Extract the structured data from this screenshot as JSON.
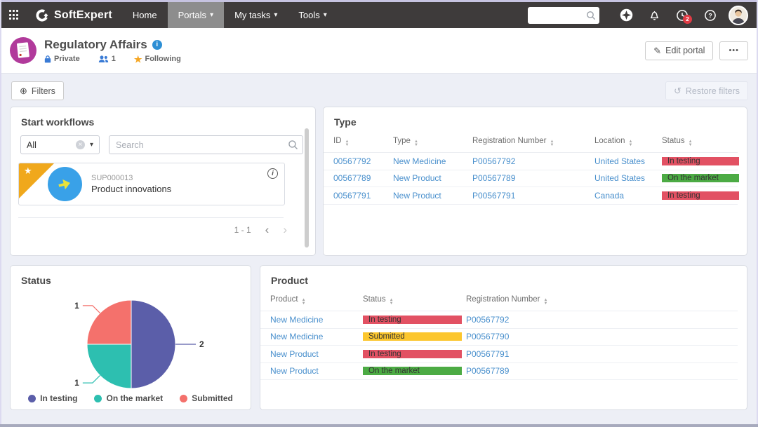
{
  "icons": {
    "caret_down": "▾",
    "sort_up": "▲",
    "sort_down": "▼",
    "ellipsis": "•••",
    "info": "i",
    "plus_circle": "⊕",
    "restore": "↺",
    "pencil": "✎",
    "star": "★",
    "clear": "×",
    "chevron_left": "‹",
    "chevron_right": "›"
  },
  "navbar": {
    "brand": "SoftExpert",
    "menu": [
      {
        "label": "Home",
        "active": false
      },
      {
        "label": "Portals",
        "active": true
      },
      {
        "label": "My tasks",
        "active": false
      },
      {
        "label": "Tools",
        "active": false
      }
    ],
    "search_value": "",
    "history_badge": "2"
  },
  "header": {
    "title": "Regulatory Affairs",
    "visibility": "Private",
    "members_count": "1",
    "following_label": "Following",
    "edit_portal_label": "Edit portal"
  },
  "filters_bar": {
    "filters_label": "Filters",
    "restore_label": "Restore filters"
  },
  "start_workflows": {
    "title": "Start workflows",
    "category_filter_value": "All",
    "search_placeholder": "Search",
    "cards": [
      {
        "id": "SUP000013",
        "name": "Product innovations"
      }
    ],
    "pagination": "1 - 1"
  },
  "type_panel": {
    "title": "Type",
    "columns": [
      "ID",
      "Type",
      "Registration Number",
      "Location",
      "Status"
    ],
    "rows": [
      {
        "id": "00567792",
        "type": "New Medicine",
        "registration_number": "P00567792",
        "location": "United States",
        "status": "In testing",
        "status_color": "#e25163"
      },
      {
        "id": "00567789",
        "type": "New Product",
        "registration_number": "P00567789",
        "location": "United States",
        "status": "On the market",
        "status_color": "#4cab44"
      },
      {
        "id": "00567791",
        "type": "New Product",
        "registration_number": "P00567791",
        "location": "Canada",
        "status": "In testing",
        "status_color": "#e25163"
      }
    ]
  },
  "status_panel": {
    "title": "Status"
  },
  "product_panel": {
    "title": "Product",
    "columns": [
      "Product",
      "Status",
      "Registration Number"
    ],
    "rows": [
      {
        "product": "New Medicine",
        "status": "In testing",
        "status_color": "#e25163",
        "registration_number": "P00567792"
      },
      {
        "product": "New Medicine",
        "status": "Submitted",
        "status_color": "#fcc62d",
        "registration_number": "P00567790"
      },
      {
        "product": "New Product",
        "status": "In testing",
        "status_color": "#e25163",
        "registration_number": "P00567791"
      },
      {
        "product": "New Product",
        "status": "On the market",
        "status_color": "#4cab44",
        "registration_number": "P00567789"
      }
    ]
  },
  "chart_data": {
    "type": "pie",
    "title": "Status",
    "labels": [
      "In testing",
      "On the market",
      "Submitted"
    ],
    "values": [
      2,
      1,
      1
    ],
    "colors": [
      "#5b5ea9",
      "#2dbfb0",
      "#f4716c"
    ],
    "legend_position": "bottom",
    "start_angle": "top",
    "direction": "clockwise"
  },
  "theme": {
    "navbar_bg": "#3e3b3b",
    "page_bg": "#edeff6",
    "link_color": "#4a90cd",
    "status_red": "#e25163",
    "status_green": "#4cab44",
    "status_yellow": "#fcc62d"
  }
}
